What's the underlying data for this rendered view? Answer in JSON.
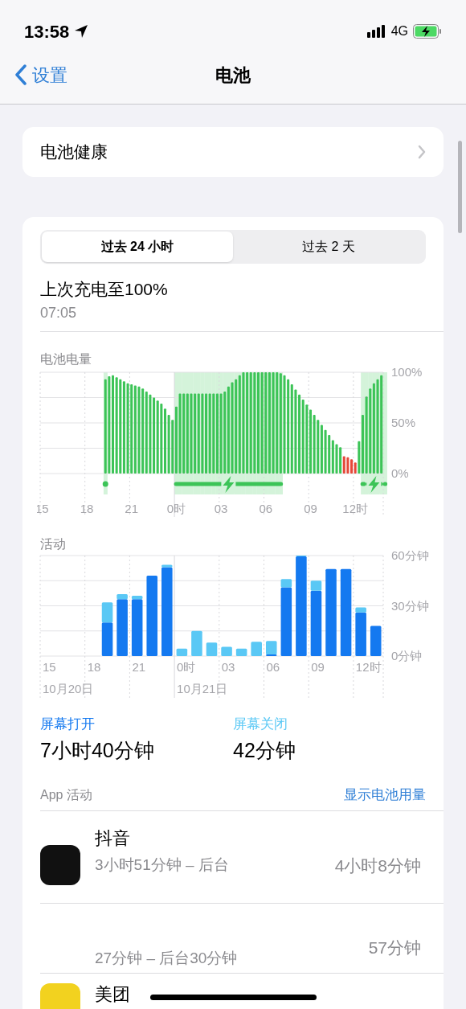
{
  "status_bar": {
    "time": "13:58",
    "network": "4G"
  },
  "nav": {
    "back": "设置",
    "title": "电池"
  },
  "health": {
    "label": "电池健康"
  },
  "range_tabs": [
    {
      "label": "过去 24 小时",
      "selected": true
    },
    {
      "label": "过去 2 天",
      "selected": false
    }
  ],
  "last_charge": {
    "label": "上次充电至100%",
    "time": "07:05"
  },
  "battery_level": {
    "chart_data": {
      "type": "bar",
      "title": "电池电量",
      "ylim": [
        0,
        100
      ],
      "yticks": [
        {
          "value": 0,
          "label": "0%"
        },
        {
          "value": 50,
          "label": "50%"
        },
        {
          "value": 100,
          "label": "100%"
        }
      ],
      "categories": [
        "15",
        null,
        null,
        null,
        null,
        null,
        null,
        null,
        null,
        null,
        null,
        null,
        "18",
        null,
        null,
        null,
        null,
        null,
        null,
        null,
        null,
        null,
        null,
        null,
        "21",
        null,
        null,
        null,
        null,
        null,
        null,
        null,
        null,
        null,
        null,
        null,
        "0时",
        null,
        null,
        null,
        null,
        null,
        null,
        null,
        null,
        null,
        null,
        null,
        "03",
        null,
        null,
        null,
        null,
        null,
        null,
        null,
        null,
        null,
        null,
        null,
        "06",
        null,
        null,
        null,
        null,
        null,
        null,
        null,
        null,
        null,
        null,
        null,
        "09",
        null,
        null,
        null,
        null,
        null,
        null,
        null,
        null,
        null,
        null,
        null,
        "12时",
        null,
        null,
        null,
        null,
        null,
        null,
        null
      ],
      "values": [
        null,
        null,
        null,
        null,
        null,
        null,
        null,
        null,
        null,
        null,
        null,
        null,
        null,
        null,
        null,
        null,
        null,
        93,
        96,
        97,
        95,
        93,
        91,
        89,
        88,
        87,
        86,
        84,
        81,
        78,
        75,
        72,
        69,
        64,
        58,
        53,
        66,
        79,
        79,
        79,
        79,
        79,
        79,
        79,
        79,
        79,
        79,
        79,
        79,
        81,
        86,
        90,
        93,
        97,
        100,
        100,
        100,
        100,
        100,
        100,
        100,
        100,
        100,
        100,
        99,
        97,
        93,
        88,
        83,
        78,
        73,
        68,
        63,
        58,
        53,
        48,
        43,
        38,
        33,
        29,
        26,
        17,
        16,
        14,
        11,
        32,
        58,
        76,
        84,
        89,
        93,
        97
      ]
    },
    "charging": [
      false,
      false,
      false,
      false,
      false,
      false,
      false,
      false,
      false,
      false,
      false,
      false,
      false,
      false,
      false,
      false,
      false,
      true,
      false,
      false,
      false,
      false,
      false,
      false,
      false,
      false,
      false,
      false,
      false,
      false,
      false,
      false,
      false,
      false,
      false,
      false,
      true,
      true,
      true,
      true,
      true,
      true,
      true,
      true,
      true,
      true,
      true,
      true,
      true,
      true,
      true,
      true,
      true,
      true,
      true,
      true,
      true,
      true,
      true,
      true,
      true,
      true,
      true,
      true,
      true,
      false,
      false,
      false,
      false,
      false,
      false,
      false,
      false,
      false,
      false,
      false,
      false,
      false,
      false,
      false,
      false,
      false,
      false,
      false,
      false,
      false,
      true,
      true,
      true,
      true,
      true,
      true,
      true
    ]
  },
  "activity": {
    "chart_data": {
      "type": "bar",
      "title": "活动",
      "stacked": true,
      "ylim": [
        0,
        60
      ],
      "categories": [
        "15",
        null,
        null,
        "18",
        null,
        null,
        "21",
        null,
        null,
        "0时",
        null,
        null,
        "03",
        null,
        null,
        "06",
        null,
        null,
        "09",
        null,
        null,
        "12时",
        null
      ],
      "yticks": [
        {
          "value": 0,
          "label": "0分钟"
        },
        {
          "value": 30,
          "label": "30分钟"
        },
        {
          "value": 60,
          "label": "60分钟"
        }
      ],
      "series": [
        {
          "name": "屏幕打开",
          "color": "#1479f0",
          "values": [
            null,
            null,
            null,
            null,
            20,
            34,
            34,
            48,
            53,
            0,
            0,
            0,
            0,
            0,
            0,
            1,
            41,
            59.5,
            39,
            52,
            52,
            26,
            18
          ]
        },
        {
          "name": "屏幕关闭",
          "color": "#5ac8f5",
          "values": [
            null,
            null,
            null,
            null,
            12,
            3,
            2,
            0,
            1.5,
            4.5,
            15,
            8,
            5.5,
            4.5,
            8.5,
            8,
            5,
            0.5,
            6,
            0,
            0,
            3,
            0
          ]
        }
      ],
      "annotations": [
        "10月20日",
        "10月21日"
      ]
    }
  },
  "summary": [
    {
      "value": "7小时40分钟"
    },
    {
      "value": "42分钟"
    }
  ],
  "app_activity": {
    "title": "App 活动",
    "link": "显示电池用量",
    "apps": [
      {
        "name": "抖音",
        "detail": "3小时51分钟 – 后台",
        "total": "4小时8分钟",
        "color": "#111111"
      },
      {
        "detail": "27分钟 – 后台30分钟",
        "total": "57分钟"
      },
      {
        "name": "美团",
        "color": "#f2d21f"
      }
    ]
  }
}
